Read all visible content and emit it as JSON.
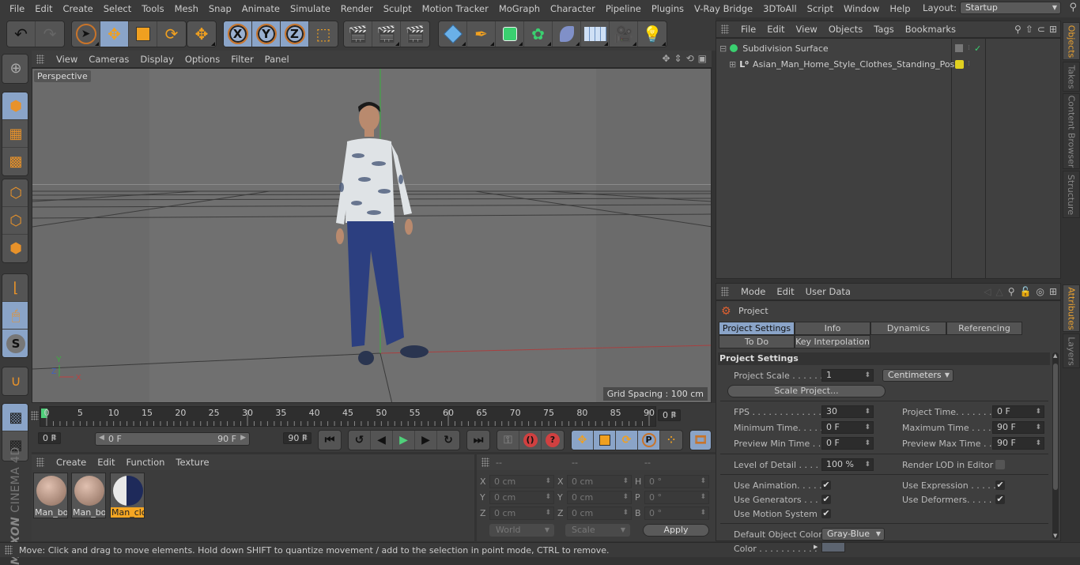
{
  "menubar": {
    "items": [
      "File",
      "Edit",
      "Create",
      "Select",
      "Tools",
      "Mesh",
      "Snap",
      "Animate",
      "Simulate",
      "Render",
      "Sculpt",
      "Motion Tracker",
      "MoGraph",
      "Character",
      "Pipeline",
      "Plugins",
      "V-Ray Bridge",
      "3DToAll",
      "Script",
      "Window",
      "Help"
    ],
    "layout_label": "Layout:",
    "layout_value": "Startup"
  },
  "toolbar": {
    "undo": "undo-icon",
    "redo": "redo-icon",
    "axis_x": "X",
    "axis_y": "Y",
    "axis_z": "Z"
  },
  "viewport": {
    "menu": [
      "View",
      "Cameras",
      "Display",
      "Options",
      "Filter",
      "Panel"
    ],
    "camera_label": "Perspective",
    "grid_spacing": "Grid Spacing : 100 cm",
    "axis_labels": {
      "x": "X",
      "y": "Y",
      "z": "Z"
    }
  },
  "timeline": {
    "ticks": [
      "0",
      "5",
      "10",
      "15",
      "20",
      "25",
      "30",
      "35",
      "40",
      "45",
      "50",
      "55",
      "60",
      "65",
      "70",
      "75",
      "80",
      "85",
      "90"
    ],
    "current_frame": "0 F",
    "start_field": "0 F",
    "range_start": "0 F",
    "range_end": "90 F",
    "end_field": "90 F"
  },
  "materials": {
    "menu": [
      "Create",
      "Edit",
      "Function",
      "Texture"
    ],
    "items": [
      {
        "name": "Man_bo",
        "selected": false
      },
      {
        "name": "Man_bo",
        "selected": false
      },
      {
        "name": "Man_clc",
        "selected": true
      }
    ]
  },
  "coordinates": {
    "headers": [
      "--",
      "--",
      "--"
    ],
    "rows": [
      {
        "a1": "X",
        "v1": "0 cm",
        "a2": "X",
        "v2": "0 cm",
        "a3": "H",
        "v3": "0 °"
      },
      {
        "a1": "Y",
        "v1": "0 cm",
        "a2": "Y",
        "v2": "0 cm",
        "a3": "P",
        "v3": "0 °"
      },
      {
        "a1": "Z",
        "v1": "0 cm",
        "a2": "Z",
        "v2": "0 cm",
        "a3": "B",
        "v3": "0 °"
      }
    ],
    "mode_dropdown": "World",
    "size_dropdown": "Scale",
    "apply_label": "Apply"
  },
  "logo": {
    "brand": "MAXON",
    "product": "CINEMA 4D"
  },
  "status": {
    "text": "Move: Click and drag to move elements. Hold down SHIFT to quantize movement / add to the selection in point mode, CTRL to remove."
  },
  "objects": {
    "menu": [
      "File",
      "Edit",
      "View",
      "Objects",
      "Tags",
      "Bookmarks"
    ],
    "tree": [
      {
        "name": "Subdivision Surface",
        "expander": "⊟"
      },
      {
        "name": "Asian_Man_Home_Style_Clothes_Standing_Pose",
        "expander": "⊞"
      }
    ]
  },
  "side_tabs_top": [
    "Objects",
    "Takes",
    "Content Browser",
    "Structure"
  ],
  "side_tabs_bottom": [
    "Attributes",
    "Layers"
  ],
  "attributes": {
    "menu": [
      "Mode",
      "Edit",
      "User Data"
    ],
    "title": "Project",
    "tabs_row1": [
      "Project Settings",
      "Info",
      "Dynamics",
      "Referencing"
    ],
    "tabs_row2": [
      "To Do",
      "Key Interpolation"
    ],
    "section": "Project Settings",
    "project_scale_label": "Project Scale . . . . . .",
    "project_scale_value": "1",
    "project_scale_unit": "Centimeters",
    "scale_project_button": "Scale Project...",
    "fps_label": "FPS . . . . . . . . . . . . . .",
    "fps_value": "30",
    "project_time_label": "Project Time. . . . . . . .",
    "project_time_value": "0 F",
    "min_time_label": "Minimum Time. . . . .",
    "min_time_value": "0 F",
    "max_time_label": "Maximum Time . . . . .",
    "max_time_value": "90 F",
    "preview_min_label": "Preview Min Time . .",
    "preview_min_value": "0 F",
    "preview_max_label": "Preview Max Time . . .",
    "preview_max_value": "90 F",
    "lod_label": "Level of Detail . . . . .",
    "lod_value": "100 %",
    "render_lod_label": "Render LOD in Editor",
    "use_animation_label": "Use Animation. . . . .",
    "use_expression_label": "Use Expression . . . . .",
    "use_generators_label": "Use Generators . . . .",
    "use_deformers_label": "Use Deformers. . . . . .",
    "use_motion_label": "Use Motion System",
    "check_mark": "✔",
    "default_color_label": "Default Object Color",
    "default_color_value": "Gray-Blue",
    "color_label": "Color . . . . . . . . . . .",
    "color_swatch": "#5c6470"
  },
  "colors": {
    "accent_blue": "#8aa4c8",
    "orange": "#e8922a",
    "playhead_green": "#4fd07a",
    "tab_active": "#e8a030"
  }
}
